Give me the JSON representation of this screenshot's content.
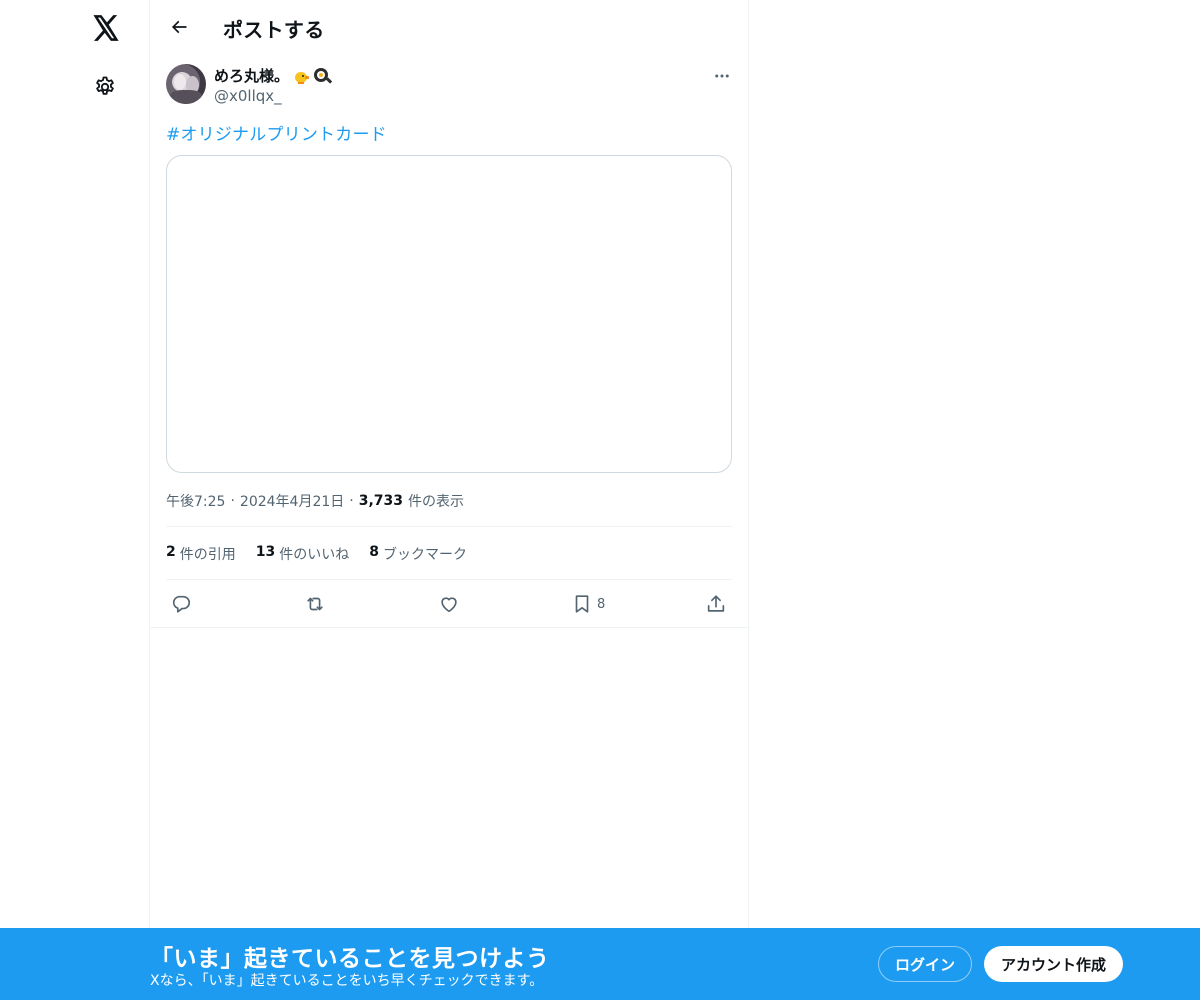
{
  "app": {
    "logo_icon": "x-logo-icon",
    "settings_icon": "gear-icon"
  },
  "header": {
    "title": "ポストする",
    "back_icon": "arrow-left-icon"
  },
  "post": {
    "author": {
      "display_name": "めろ丸様。",
      "emojis": [
        "chick-emoji",
        "frying-pan-egg-emoji"
      ],
      "handle": "@x0llqx_"
    },
    "more_icon": "ellipsis-icon",
    "hashtag": "#オリジナルプリントカード",
    "meta": {
      "time": "午後7:25",
      "separator": "·",
      "date": "2024年4月21日",
      "views_count": "3,733",
      "views_label": "件の表示"
    },
    "stats": {
      "quotes_count": "2",
      "quotes_label": "件の引用",
      "likes_count": "13",
      "likes_label": "件のいいね",
      "bookmarks_count": "8",
      "bookmarks_label": "ブックマーク"
    },
    "actions": {
      "reply_icon": "reply-icon",
      "repost_icon": "repost-icon",
      "like_icon": "heart-icon",
      "bookmark_icon": "bookmark-icon",
      "bookmark_count": "8",
      "share_icon": "share-icon"
    }
  },
  "banner": {
    "title": "「いま」起きていることを見つけよう",
    "subtitle": "Xなら、「いま」起きていることをいち早くチェックできます。",
    "login_label": "ログイン",
    "signup_label": "アカウント作成",
    "background": "#1d9bf0"
  },
  "colors": {
    "accent": "#1d9bf0",
    "text": "#0f1419",
    "muted": "#536471",
    "border": "#eff3f4"
  }
}
